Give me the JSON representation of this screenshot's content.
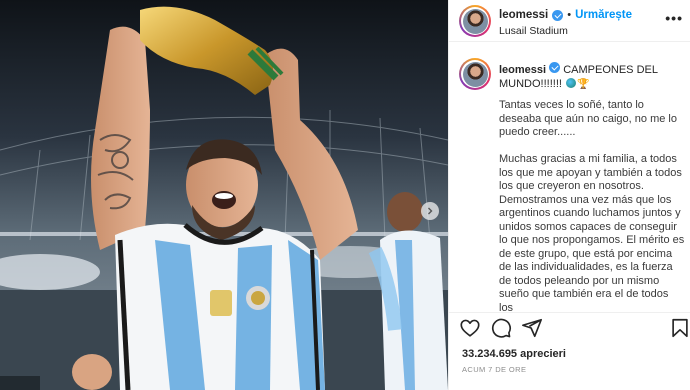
{
  "post": {
    "username": "leomessi",
    "follow_label": "Urmărește",
    "separator": "•",
    "location": "Lusail Stadium",
    "more_label": "•••"
  },
  "caption": {
    "headline": "CAMPEONES DEL MUNDO!!!!!!!",
    "paragraphs": [
      "Tantas veces lo soñé, tanto lo deseaba que aún no caigo, no me lo puedo creer......",
      "Muchas gracias a mi familia, a todos los que me apoyan y también a todos los que creyeron en nosotros. Demostramos una vez más que los argentinos cuando luchamos juntos y unidos somos capaces de conseguir lo que nos propongamos. El mérito es de este grupo, que está por encima de las individualidades, es la fuerza de todos peleando por un mismo sueño que también era el de todos los"
    ]
  },
  "stats": {
    "likes": "33.234.695 aprecieri",
    "time_ago": "ACUM 7 DE ORE"
  },
  "icons": {
    "like": "heart-icon",
    "comment": "comment-icon",
    "share": "share-icon",
    "save": "bookmark-icon",
    "next": "chevron-right-icon",
    "verified": "verified-badge-icon"
  },
  "colors": {
    "link": "#0095f6",
    "verified": "#3897f0",
    "text": "#262626",
    "muted": "#8e8e8e"
  }
}
